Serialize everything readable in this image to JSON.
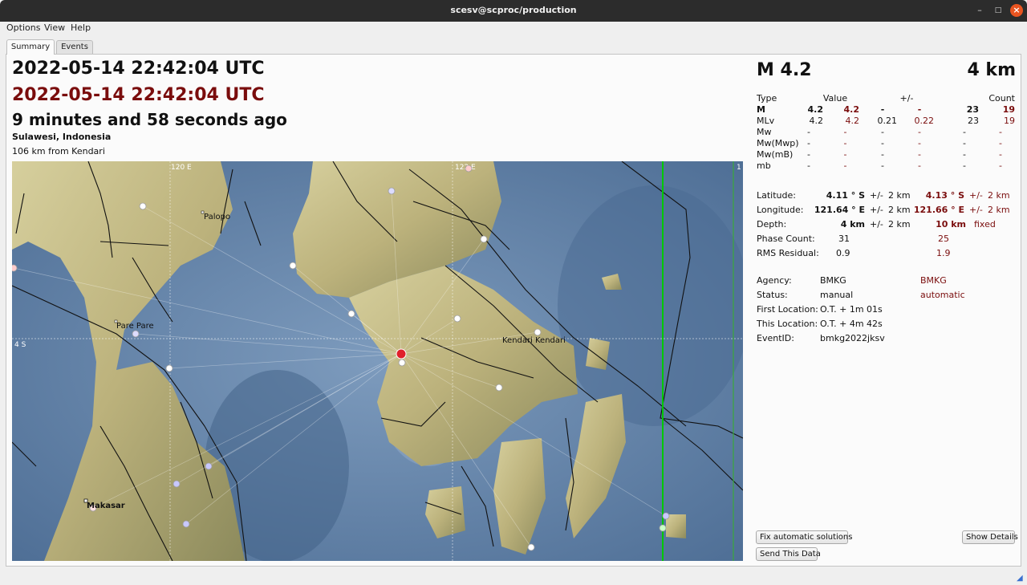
{
  "window": {
    "title": "scesv@scproc/production"
  },
  "menu": {
    "options": "Options",
    "view": "View",
    "help": "Help"
  },
  "tabs": {
    "summary": "Summary",
    "events": "Events"
  },
  "summary": {
    "origin_time": "2022-05-14 22:42:04 UTC",
    "origin_time_auto": "2022-05-14 22:42:04 UTC",
    "elapsed": "9 minutes and 58 seconds ago",
    "region": "Sulawesi, Indonesia",
    "nearest_city": "106 km from Kendari",
    "magnitude": "M 4.2",
    "depth": "4 km"
  },
  "magnitudes": {
    "headers": {
      "type": "Type",
      "value": "Value",
      "error": "+/-",
      "count": "Count"
    },
    "rows": [
      {
        "type": "M",
        "value": "4.2",
        "value_auto": "4.2",
        "err": "-",
        "err_auto": "-",
        "count": "23",
        "count_auto": "19",
        "bold": true
      },
      {
        "type": "MLv",
        "value": "4.2",
        "value_auto": "4.2",
        "err": "0.21",
        "err_auto": "0.22",
        "count": "23",
        "count_auto": "19",
        "bold": false
      },
      {
        "type": "Mw",
        "value": "-",
        "value_auto": "-",
        "err": "-",
        "err_auto": "-",
        "count": "-",
        "count_auto": "-",
        "bold": false
      },
      {
        "type": "Mw(Mwp)",
        "value": "-",
        "value_auto": "-",
        "err": "-",
        "err_auto": "-",
        "count": "-",
        "count_auto": "-",
        "bold": false
      },
      {
        "type": "Mw(mB)",
        "value": "-",
        "value_auto": "-",
        "err": "-",
        "err_auto": "-",
        "count": "-",
        "count_auto": "-",
        "bold": false
      },
      {
        "type": "mb",
        "value": "-",
        "value_auto": "-",
        "err": "-",
        "err_auto": "-",
        "count": "-",
        "count_auto": "-",
        "bold": false
      }
    ]
  },
  "location": {
    "latitude_label": "Latitude:",
    "latitude": "4.11 ° S",
    "latitude_pm": "+/-",
    "latitude_err": "2 km",
    "latitude_auto": "4.13 ° S",
    "latitude_auto_pm": "+/-",
    "latitude_auto_err": "2 km",
    "longitude_label": "Longitude:",
    "longitude": "121.64 ° E",
    "longitude_pm": "+/-",
    "longitude_err": "2 km",
    "longitude_auto": "121.66 ° E",
    "longitude_auto_pm": "+/-",
    "longitude_auto_err": "2 km",
    "depth_label": "Depth:",
    "depth": "4 km",
    "depth_pm": "+/-",
    "depth_err": "2 km",
    "depth_auto": "10 km",
    "depth_auto_status": "fixed",
    "phase_count_label": "Phase Count:",
    "phase_count": "31",
    "phase_count_auto": "25",
    "rms_label": "RMS Residual:",
    "rms": "0.9",
    "rms_auto": "1.9"
  },
  "info": {
    "agency_label": "Agency:",
    "agency": "BMKG",
    "agency_auto": "BMKG",
    "status_label": "Status:",
    "status": "manual",
    "status_auto": "automatic",
    "first_location_label": "First Location:",
    "first_location": "O.T. + 1m 01s",
    "this_location_label": "This Location:",
    "this_location": "O.T. + 4m 42s",
    "event_id_label": "EventID:",
    "event_id": "bmkg2022jksv"
  },
  "buttons": {
    "fix_automatic": "Fix automatic solutions",
    "show_details": "Show Details",
    "send_data": "Send This Data"
  },
  "map": {
    "grid_labels": {
      "lon1": "120 E",
      "lon2": "122 E",
      "lon3": "1",
      "lat1": "4 S"
    },
    "cities": [
      "Palopo",
      "Pare Pare",
      "Kendari",
      "Kendari",
      "Makasar"
    ],
    "colors": {
      "sea": "#5d7fa6",
      "land": "#c2ba86",
      "epicenter": "#e0202a",
      "border_line": "#00c800"
    }
  },
  "colors": {
    "automatic_text": "#7a0d0d"
  }
}
